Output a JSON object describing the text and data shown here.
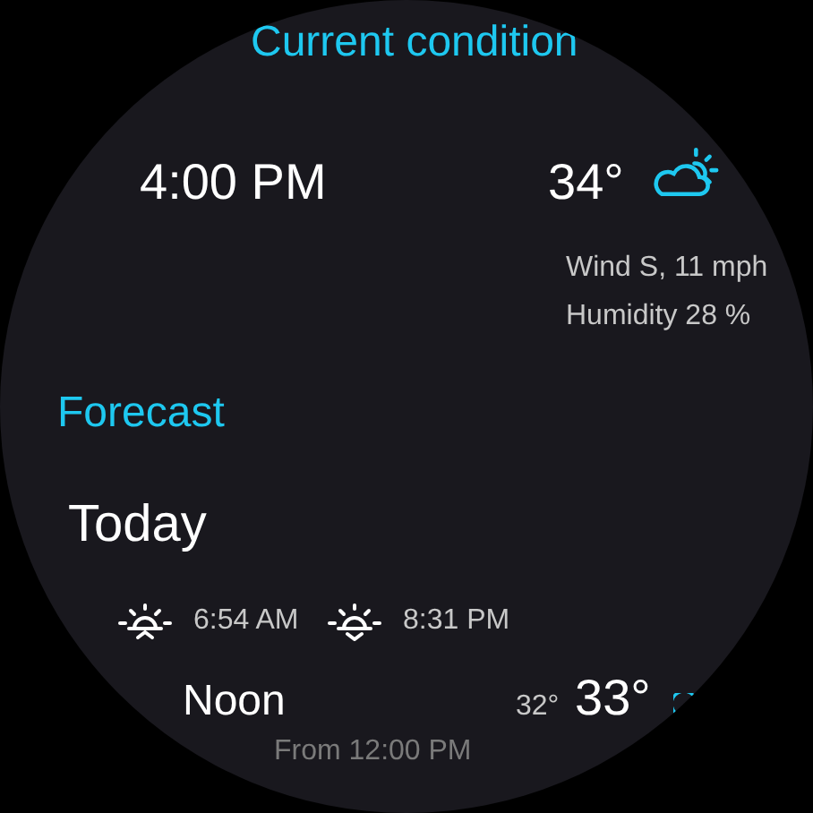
{
  "current": {
    "title": "Current condition",
    "time": "4:00 PM",
    "temperature": "34°",
    "wind": "Wind S, 11 mph",
    "humidity": "Humidity 28 %"
  },
  "forecast": {
    "title": "Forecast",
    "day": "Today",
    "sunrise": "6:54 AM",
    "sunset": "8:31 PM",
    "periods": [
      {
        "name": "Noon",
        "low": "32°",
        "high": "33°",
        "from": "From 12:00 PM"
      }
    ]
  }
}
